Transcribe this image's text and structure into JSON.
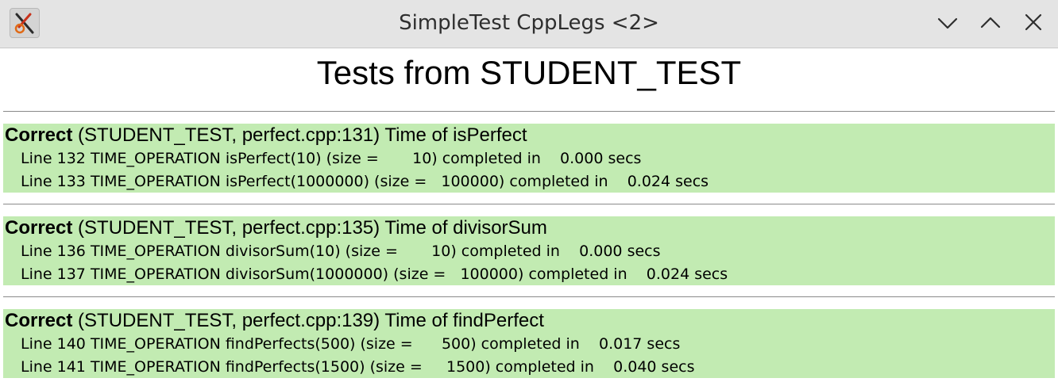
{
  "window": {
    "title": "SimpleTest CppLegs <2>",
    "icon": "app-logo-icon",
    "controls": [
      "chevron-down-icon",
      "chevron-up-icon",
      "close-icon"
    ]
  },
  "page": {
    "heading": "Tests from STUDENT_TEST"
  },
  "colors": {
    "pass_background": "#c2ebb2",
    "titlebar": "#e4e4e4"
  },
  "results": [
    {
      "status": "Correct",
      "header": " (STUDENT_TEST, perfect.cpp:131) Time of isPerfect",
      "lines": [
        "Line 132 TIME_OPERATION isPerfect(10) (size =       10) completed in    0.000 secs",
        "Line 133 TIME_OPERATION isPerfect(1000000) (size =   100000) completed in    0.024 secs"
      ]
    },
    {
      "status": "Correct",
      "header": " (STUDENT_TEST, perfect.cpp:135) Time of divisorSum",
      "lines": [
        "Line 136 TIME_OPERATION divisorSum(10) (size =       10) completed in    0.000 secs",
        "Line 137 TIME_OPERATION divisorSum(1000000) (size =   100000) completed in    0.024 secs"
      ]
    },
    {
      "status": "Correct",
      "header": " (STUDENT_TEST, perfect.cpp:139) Time of findPerfect",
      "lines": [
        "Line 140 TIME_OPERATION findPerfects(500) (size =      500) completed in    0.017 secs",
        "Line 141 TIME_OPERATION findPerfects(1500) (size =     1500) completed in    0.040 secs"
      ]
    }
  ]
}
